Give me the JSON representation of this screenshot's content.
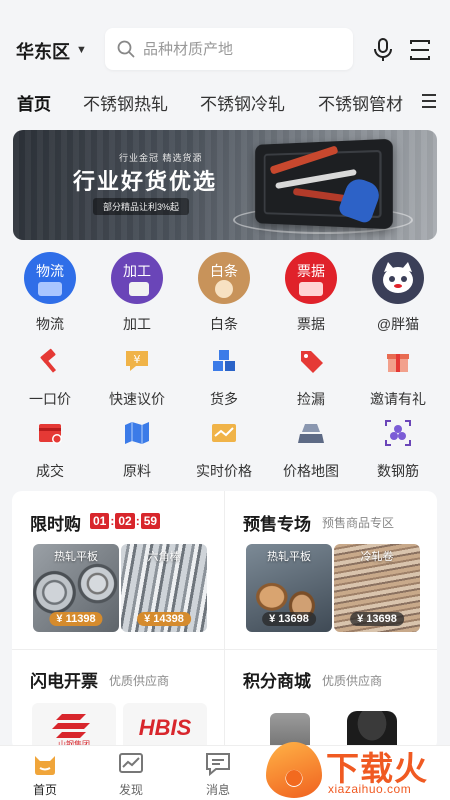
{
  "header": {
    "region": "华东区",
    "search_placeholder": "品种材质产地"
  },
  "tabs": [
    "首页",
    "不锈钢热轧",
    "不锈钢冷轧",
    "不锈钢管材"
  ],
  "banner": {
    "small": "行业金冠 精选货源",
    "big": "行业好货优选",
    "pill": "部分精品让利3%起"
  },
  "services": [
    {
      "icon_text": "物流",
      "label": "物流",
      "color": "#2f6ee8"
    },
    {
      "icon_text": "加工",
      "label": "加工",
      "color": "#6a45b8"
    },
    {
      "icon_text": "白条",
      "label": "白条",
      "color": "#c8935a"
    },
    {
      "icon_text": "票据",
      "label": "票据",
      "color": "#e0222a"
    },
    {
      "icon_text": "",
      "label": "@胖猫",
      "color": "#3b3f58"
    }
  ],
  "grid_row1": [
    "一口价",
    "快速议价",
    "货多",
    "捡漏",
    "邀请有礼"
  ],
  "grid_row2": [
    "成交",
    "原料",
    "实时价格",
    "价格地图",
    "数钢筋"
  ],
  "flash": {
    "title": "限时购",
    "timer": [
      "01",
      "02",
      "59"
    ],
    "products": [
      {
        "name": "热轧平板",
        "price": "¥ 11398"
      },
      {
        "name": "六角棒",
        "price": "¥ 14398"
      }
    ]
  },
  "presale": {
    "title": "预售专场",
    "subtitle": "预售商品专区",
    "products": [
      {
        "name": "热轧平板",
        "price": "¥ 13698"
      },
      {
        "name": "冷轧卷",
        "price": "¥ 13698"
      }
    ]
  },
  "invoice": {
    "title": "闪电开票",
    "subtitle": "优质供应商",
    "logos": [
      "山钢集团",
      "HBIS"
    ]
  },
  "points": {
    "title": "积分商城",
    "subtitle": "优质供应商"
  },
  "bottom_nav": [
    "首页",
    "发现",
    "消息"
  ],
  "watermark": {
    "text": "下载火",
    "url": "xiazaihuo.com"
  }
}
